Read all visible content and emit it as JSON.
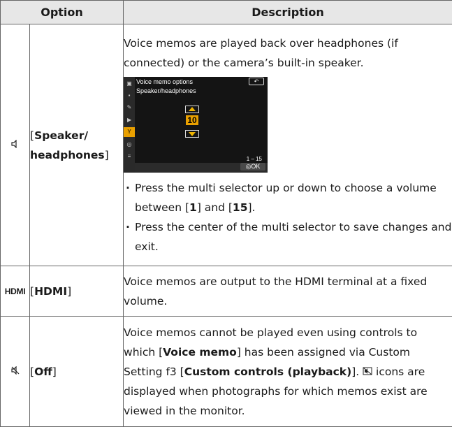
{
  "header": {
    "option": "Option",
    "description": "Description"
  },
  "rows": [
    {
      "icon": "speaker-icon",
      "icon_glyph": "🔈",
      "open": "[",
      "name_bold_1": "Speaker/",
      "name_bold_2": "headphones",
      "close": "]",
      "desc": "Voice memos are played back over headphones (if connected) or the camera’s built-in speaker.",
      "screen": {
        "title": "Voice memo options",
        "back_label": "↶",
        "subtitle": "Speaker/headphones",
        "value": "10",
        "range": "1 – 15",
        "ok_label": "◎OK",
        "side_icons": [
          "camera-icon",
          "movie-icon",
          "pencil-icon",
          "playback-icon",
          "setup-icon",
          "retouch-icon",
          "mymenu-icon"
        ],
        "side_glyphs": [
          "▣",
          "▪",
          "✎",
          "▶",
          "Y",
          "◎",
          "≡"
        ],
        "active_index": 4
      },
      "bullets": [
        {
          "pre": "Press the multi selector up or down to choose a volume between [",
          "b1": "1",
          "mid": "] and [",
          "b2": "15",
          "post": "]."
        },
        {
          "text": "Press the center of the multi selector to save changes and exit."
        }
      ]
    },
    {
      "icon": "hdmi-icon",
      "icon_glyph": "HDMI",
      "open": "[",
      "name_bold": "HDMI",
      "close": "]",
      "desc": "Voice memos are output to the HDMI terminal at a fixed volume."
    },
    {
      "icon": "speaker-muted-icon",
      "icon_glyph": "🔇",
      "open": "[",
      "name_bold": "Off",
      "close": "]",
      "desc_pre": "Voice memos cannot be played even using controls to which [",
      "desc_b1": "Voice memo",
      "desc_mid": "] has been assigned via Custom Setting f3 [",
      "desc_b2": "Custom controls (playback)",
      "desc_mid2": "]. ",
      "desc_inline_glyph": "⊘",
      "desc_post": " icons are displayed when photographs for which memos exist are viewed in the monitor."
    }
  ]
}
